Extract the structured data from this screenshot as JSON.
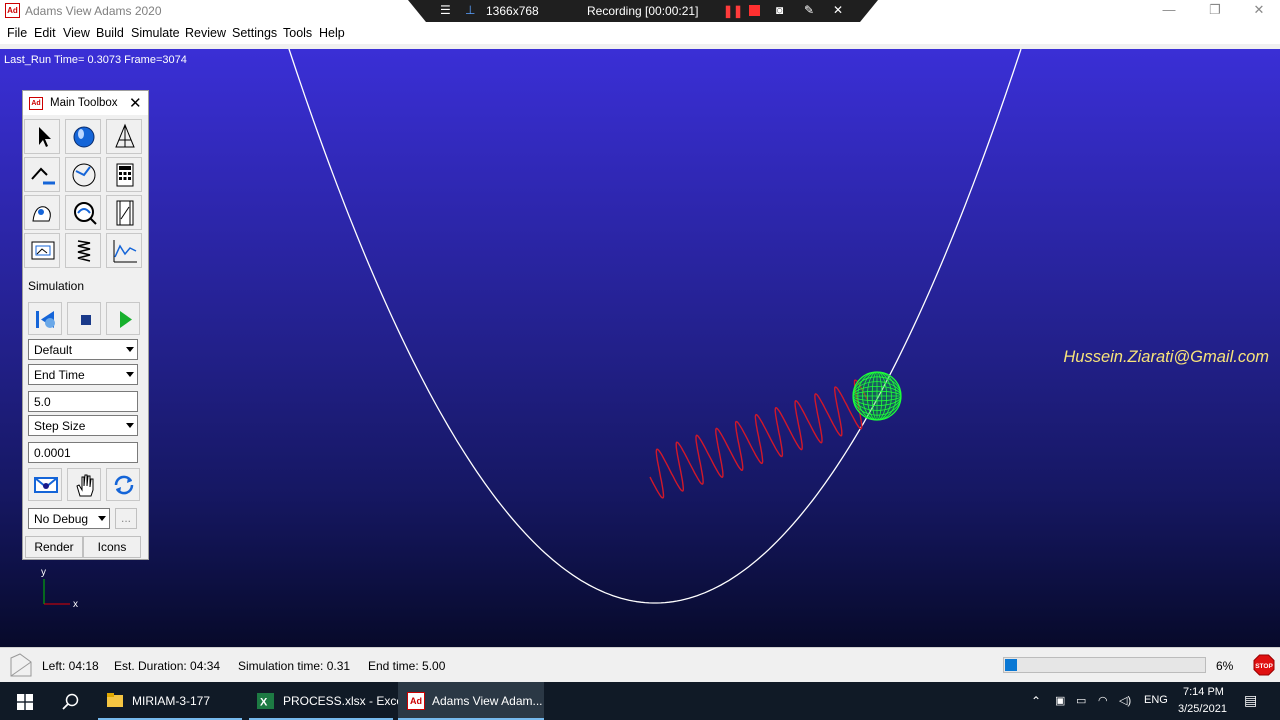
{
  "window": {
    "app_icon_text": "Ad",
    "title": "Adams View Adams 2020",
    "min_glyph": "—",
    "max_glyph": "❐",
    "close_glyph": "✕"
  },
  "recorder": {
    "resolution": "1366x768",
    "status": "Recording [00:00:21]"
  },
  "menu": {
    "items": [
      "File",
      "Edit",
      "View",
      "Build",
      "Simulate",
      "Review",
      "Settings",
      "Tools",
      "Help"
    ]
  },
  "viewport": {
    "run_info": "Last_Run   Time= 0.3073  Frame=3074",
    "watermark": "Hussein.Ziarati@Gmail.com",
    "triad_y": "y",
    "triad_x": "x",
    "colors": {
      "curve": "#ffffff",
      "spring": "#d0182a",
      "ball": "#1dff3a",
      "background_top": "#3a2fd6",
      "background_bottom": "#070a2a"
    }
  },
  "toolbox": {
    "icon_text": "Ad",
    "title": "Main Toolbox",
    "close_glyph": "✕",
    "tools": [
      "select-pointer",
      "render-sphere",
      "geometry-cone",
      "connector-link",
      "motion-rotate",
      "calculator",
      "body-shape",
      "view-zoom",
      "animation-film",
      "plot-display",
      "spring-coil",
      "postprocessor-graph"
    ],
    "simulation_label": "Simulation",
    "sim_settings_select": "Default",
    "end_time_select": "End Time",
    "end_time_value": "5.0",
    "step_select": "Step Size",
    "step_value": "0.0001",
    "debug_select": "No Debug",
    "more_button": "...",
    "render_button": "Render",
    "icons_button": "Icons"
  },
  "status": {
    "left": "Left: 04:18",
    "duration": "Est. Duration: 04:34",
    "sim_time": "Simulation time: 0.31",
    "end_time": "End time: 5.00",
    "progress_percent": 6,
    "percent_label": "6%",
    "stop_label": "STOP"
  },
  "taskbar": {
    "tasks": [
      "MIRIAM-3-177",
      "PROCESS.xlsx - Excel",
      "Adams View Adam..."
    ],
    "language": "ENG",
    "time": "7:14 PM",
    "date": "3/25/2021"
  }
}
